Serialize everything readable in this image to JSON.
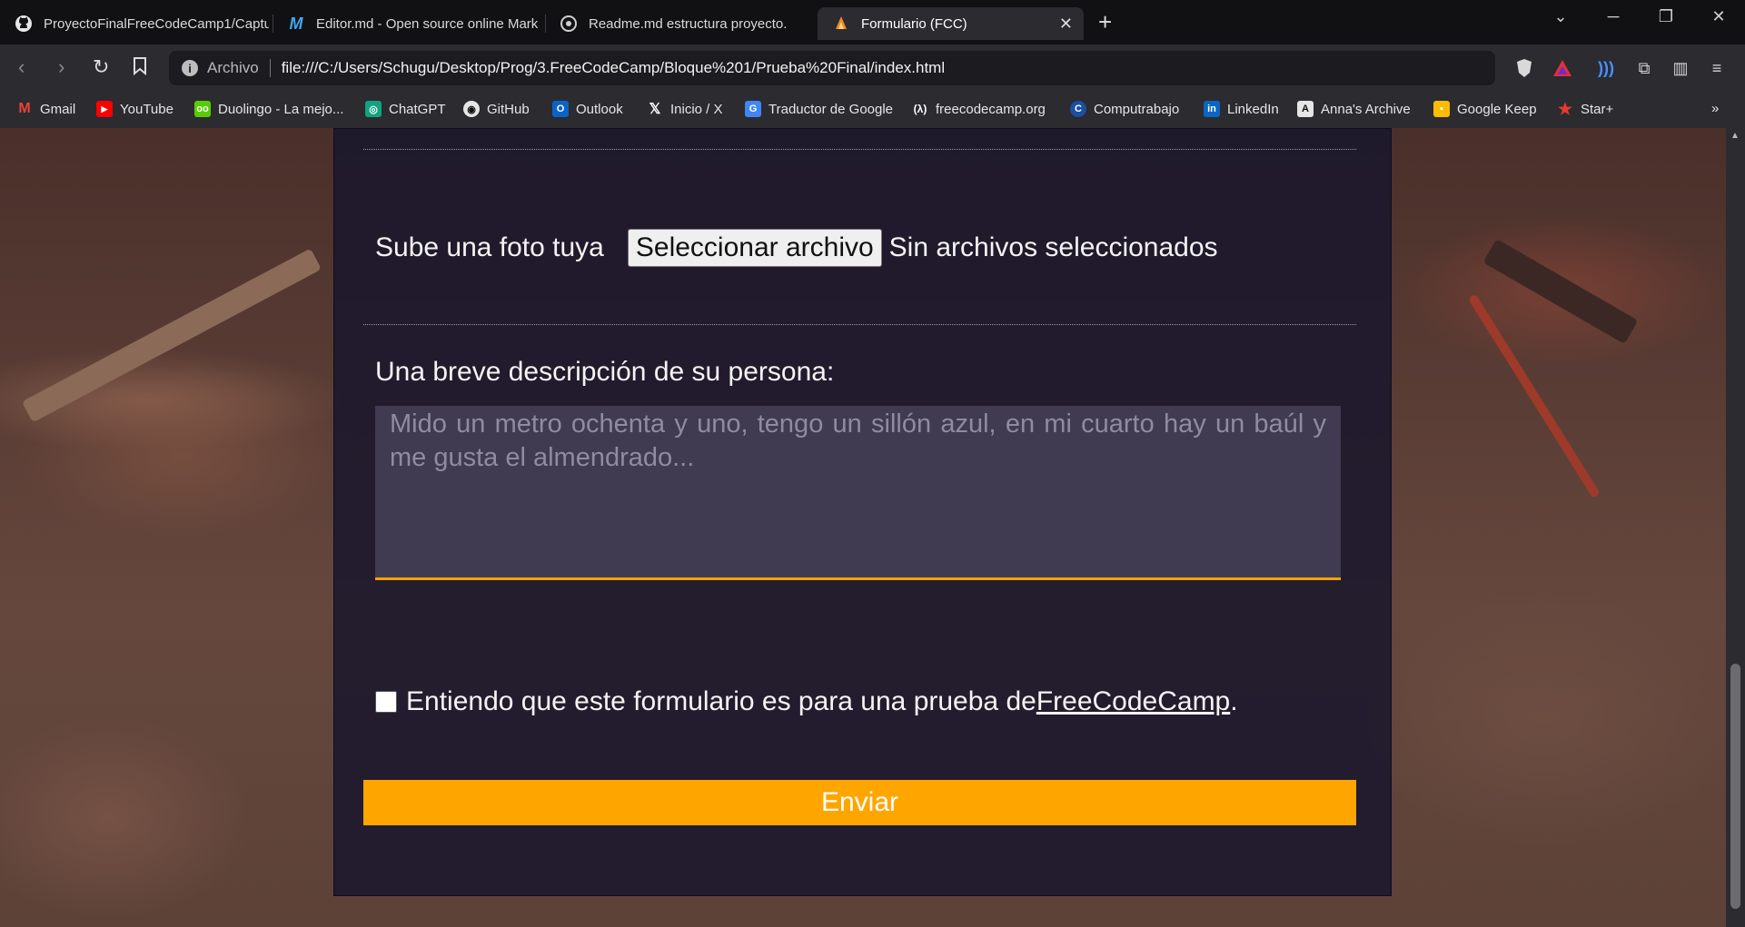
{
  "browser": {
    "tabs": [
      {
        "label": "ProyectoFinalFreeCodeCamp1/Captu",
        "icon": "github-icon",
        "active": false
      },
      {
        "label": "Editor.md - Open source online Mark",
        "icon": "editormd-icon",
        "active": false
      },
      {
        "label": "Readme.md estructura proyecto.",
        "icon": "chatgpt-icon",
        "active": false
      },
      {
        "label": "Formulario (FCC)",
        "icon": "freecodecamp-icon",
        "active": true
      }
    ],
    "address": {
      "protocol_label": "Archivo",
      "url": "file:///C:/Users/Schugu/Desktop/Prog/3.FreeCodeCamp/Bloque%201/Prueba%20Final/index.html"
    },
    "bookmarks": [
      {
        "label": "Gmail",
        "icon": "gmail-icon",
        "color": "#ea4335"
      },
      {
        "label": "YouTube",
        "icon": "youtube-icon",
        "color": "#ff0000"
      },
      {
        "label": "Duolingo - La mejo...",
        "icon": "duolingo-icon",
        "color": "#58cc02"
      },
      {
        "label": "ChatGPT",
        "icon": "chatgpt-icon",
        "color": "#10a37f"
      },
      {
        "label": "GitHub",
        "icon": "github-icon",
        "color": "#ffffff"
      },
      {
        "label": "Outlook",
        "icon": "outlook-icon",
        "color": "#0a64c8"
      },
      {
        "label": "Inicio / X",
        "icon": "x-icon",
        "color": "#000000"
      },
      {
        "label": "Traductor de Google",
        "icon": "google-translate-icon",
        "color": "#4285f4"
      },
      {
        "label": "freecodecamp.org",
        "icon": "freecodecamp-icon",
        "color": "#0a0a23"
      },
      {
        "label": "Computrabajo",
        "icon": "computrabajo-icon",
        "color": "#1b4fa3"
      },
      {
        "label": "LinkedIn",
        "icon": "linkedin-icon",
        "color": "#0a66c2"
      },
      {
        "label": "Anna's Archive",
        "icon": "annas-archive-icon",
        "color": "#222222"
      },
      {
        "label": "Google Keep",
        "icon": "google-keep-icon",
        "color": "#fbbc04"
      },
      {
        "label": "Star+",
        "icon": "star-icon",
        "color": "#e8392c"
      }
    ]
  },
  "form": {
    "photo_label": "Sube una foto tuya",
    "file_button_label": "Seleccionar archivo",
    "file_status": "Sin archivos seleccionados",
    "description_label": "Una breve descripción de su persona:",
    "description_placeholder": "Mido un metro ochenta y uno, tengo un sillón azul, en mi cuarto hay un baúl y me gusta el almendrado...",
    "consent_text": "Entiendo que este formulario es para una prueba de ",
    "consent_link": "FreeCodeCamp",
    "consent_suffix": ".",
    "consent_checked": false,
    "submit_label": "Enviar"
  },
  "colors": {
    "accent": "#ffa500",
    "panel": "#18162c"
  }
}
